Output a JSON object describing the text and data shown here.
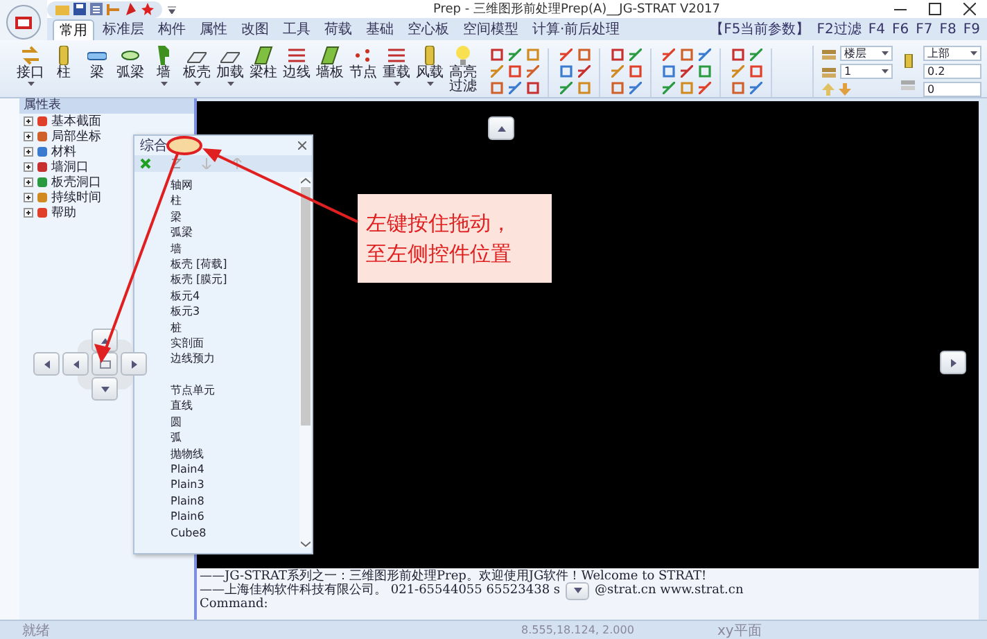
{
  "window": {
    "title": "Prep - 三维图形前处理Prep(A)__JG-STRAT V2017"
  },
  "ribbon_tabs": [
    {
      "label": "常用",
      "selected": true
    },
    {
      "label": "标准层",
      "selected": false
    },
    {
      "label": "构件",
      "selected": false
    },
    {
      "label": "属性",
      "selected": false
    },
    {
      "label": "改图",
      "selected": false
    },
    {
      "label": "工具",
      "selected": false
    },
    {
      "label": "荷载",
      "selected": false
    },
    {
      "label": "基础",
      "selected": false
    },
    {
      "label": "空心板",
      "selected": false
    },
    {
      "label": "空间模型",
      "selected": false
    },
    {
      "label": "计算·前后处理",
      "selected": false
    }
  ],
  "shortcut_keys": [
    "【F5当前参数】",
    "F2过滤",
    "F4",
    "F6",
    "F7",
    "F8",
    "F9"
  ],
  "ribbon_buttons": [
    {
      "label": "接口",
      "has_menu": true
    },
    {
      "label": "柱",
      "has_menu": false
    },
    {
      "label": "梁",
      "has_menu": false
    },
    {
      "label": "弧梁",
      "has_menu": false
    },
    {
      "label": "墙",
      "has_menu": true
    },
    {
      "label": "板壳",
      "has_menu": true
    },
    {
      "label": "加载",
      "has_menu": true
    },
    {
      "label": "梁柱",
      "has_menu": false
    },
    {
      "label": "边线",
      "has_menu": false
    },
    {
      "label": "墙板",
      "has_menu": false
    },
    {
      "label": "节点",
      "has_menu": false
    },
    {
      "label": "重载",
      "has_menu": true
    },
    {
      "label": "风载",
      "has_menu": true
    },
    {
      "label": "高亮过滤",
      "has_menu": false
    }
  ],
  "selectors": [
    {
      "kind": "dropdown",
      "value": "楼层"
    },
    {
      "kind": "dropdown",
      "value": "1"
    },
    {
      "kind": "dropdown",
      "value": "上部"
    },
    {
      "kind": "field",
      "value": "0.2"
    },
    {
      "kind": "field",
      "value": "0"
    }
  ],
  "property_panel": {
    "title": "属性表",
    "items": [
      {
        "label": "基本截面",
        "expanded": false
      },
      {
        "label": "局部坐标",
        "expanded": false
      },
      {
        "label": "材料",
        "expanded": false
      },
      {
        "label": "墙洞口",
        "expanded": false
      },
      {
        "label": "板壳洞口",
        "expanded": false
      },
      {
        "label": "持续时间",
        "expanded": false
      },
      {
        "label": "帮助",
        "expanded": false
      }
    ]
  },
  "floating_panel": {
    "title": "综合",
    "groups": [
      [
        "轴网",
        "柱",
        "梁",
        "弧梁",
        "墙",
        "板壳 [荷载]",
        "板壳 [膜元]",
        "板元4",
        "板元3",
        "桩",
        "实剖面",
        "边线预力"
      ],
      [
        "节点单元",
        "直线",
        "圆",
        "弧",
        "抛物线",
        "Plain4",
        "Plain3",
        "Plain8",
        "Plain6",
        "Cube8"
      ]
    ]
  },
  "annotation": {
    "lines": [
      "左键按住拖动，",
      "至左侧控件位置"
    ]
  },
  "console": {
    "lines": [
      "——JG-STRAT系列之一：三维图形前处理Prep。欢迎使用JG软件！Welcome to STRAT!"
    ],
    "contact_before": "——上海佳构软件科技有限公司。 021-65544055 65523438 s",
    "contact_after": "@strat.cn  www.strat.cn",
    "prompt": "Command:"
  },
  "status_bar": {
    "items": [
      "就绪",
      "8.555,18.124, 2.000",
      "xy平面"
    ]
  }
}
